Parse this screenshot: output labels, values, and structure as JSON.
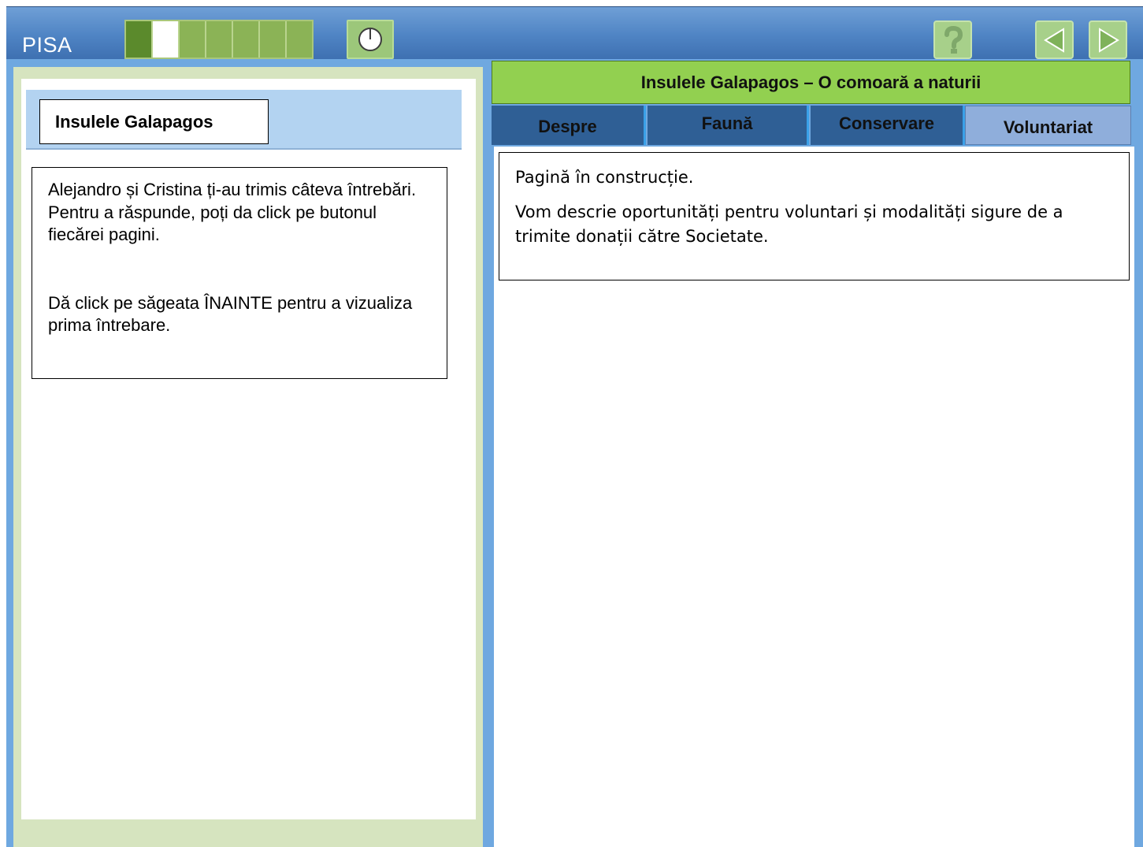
{
  "topbar": {
    "logo": "PISA",
    "progress": {
      "total_cells": 7,
      "completed": 1,
      "current_index": 1
    },
    "timer_icon": "clock-icon",
    "help_icon": "question-icon",
    "prev_icon": "triangle-left-icon",
    "next_icon": "triangle-right-icon"
  },
  "left": {
    "unit_title": "Insulele Galapagos",
    "intro": [
      "Alejandro și Cristina ți-au trimis câteva întrebări. Pentru a răspunde, poți da click pe butonul fiecărei pagini.",
      "Dă click pe săgeata ÎNAINTE pentru a vizualiza prima întrebare."
    ]
  },
  "right": {
    "site_title": "Insulele Galapagos – O comoară a naturii",
    "tabs": [
      {
        "label": "Despre",
        "active": false
      },
      {
        "label": "Faună",
        "active": false
      },
      {
        "label": "Conservare",
        "active": false
      },
      {
        "label": "Voluntariat",
        "active": true
      }
    ],
    "content": [
      "Pagină în construcție.",
      "Vom descrie oportunități pentru voluntari și modalități sigure de a trimite donații către Societate."
    ]
  },
  "colors": {
    "topbar": "#4f84c4",
    "site_title_bg": "#92d050",
    "tab_bg": "#2f5f95",
    "tab_active_bg": "#8faedb",
    "left_panel_bg": "#d6e4bf",
    "unit_bar_bg": "#b3d3f1"
  }
}
